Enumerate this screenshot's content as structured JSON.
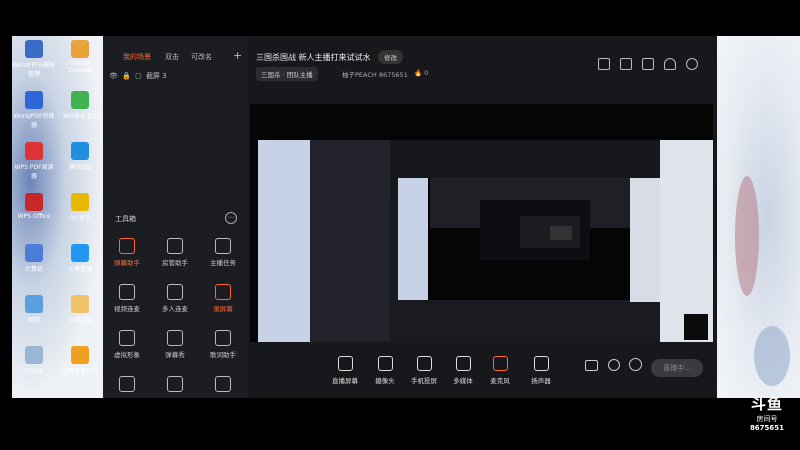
{
  "desktop_icons": [
    {
      "label": "WordPPT&模板管理"
    },
    {
      "label": "Google Chrome"
    },
    {
      "label": "Word/PDF转换器"
    },
    {
      "label": "360安全卫士"
    },
    {
      "label": "WPS PDF阅读器"
    },
    {
      "label": "腾讯QQ"
    },
    {
      "label": "WPS Office"
    },
    {
      "label": "QQ音乐"
    },
    {
      "label": "计算机"
    },
    {
      "label": "斗鱼直播"
    },
    {
      "label": "网络"
    },
    {
      "label": "小游戏库"
    },
    {
      "label": "回收站"
    },
    {
      "label": "斗鱼直播伴侣"
    }
  ],
  "scene_tabs": [
    "我的场景",
    "双击",
    "可改名"
  ],
  "scene_item": "截屏 3",
  "tools_title": "工具箱",
  "tools": [
    {
      "label": "弹幕助手",
      "icon": "danmu-icon",
      "orange": true
    },
    {
      "label": "房管助手",
      "icon": "manager-icon",
      "orange": false
    },
    {
      "label": "主播任务",
      "icon": "task-icon",
      "orange": false
    },
    {
      "label": "视频连麦",
      "icon": "video-link-icon",
      "orange": false
    },
    {
      "label": "多人连麦",
      "icon": "multi-link-icon",
      "orange": false
    },
    {
      "label": "录屏幕",
      "icon": "record-icon",
      "orange": true
    },
    {
      "label": "虚拟形象",
      "icon": "avatar-icon",
      "orange": false
    },
    {
      "label": "弹幕秀",
      "icon": "danmu-show-icon",
      "orange": false
    },
    {
      "label": "歌词助手",
      "icon": "lyrics-icon",
      "orange": false
    },
    {
      "label": "",
      "icon": "new-tool-icon",
      "orange": false
    },
    {
      "label": "",
      "icon": "download-icon",
      "orange": false
    },
    {
      "label": "",
      "icon": "game-icon",
      "orange": false
    }
  ],
  "header": {
    "title": "三国杀国战 新人主播打来试试水",
    "edit_label": "修改",
    "category": "三国杀 · 团队主播",
    "owner": "柚子PEACH",
    "room_id": "8675651",
    "hot": "0"
  },
  "bottom_tools": [
    {
      "label": "直播屏幕",
      "icon": "screen-icon"
    },
    {
      "label": "摄像头",
      "icon": "camera-icon"
    },
    {
      "label": "手机投屏",
      "icon": "phone-cast-icon"
    },
    {
      "label": "多媒体",
      "icon": "media-icon"
    },
    {
      "label": "麦克风",
      "icon": "mic-icon"
    },
    {
      "label": "扬声器",
      "icon": "speaker-icon"
    }
  ],
  "golive_label": "直播中...",
  "watermark": {
    "brand": "斗鱼",
    "text": "房间号",
    "room": "8675651"
  },
  "colors": {
    "accent": "#ff6a2c",
    "panel": "#1c1d22",
    "bg": "#17181c"
  }
}
